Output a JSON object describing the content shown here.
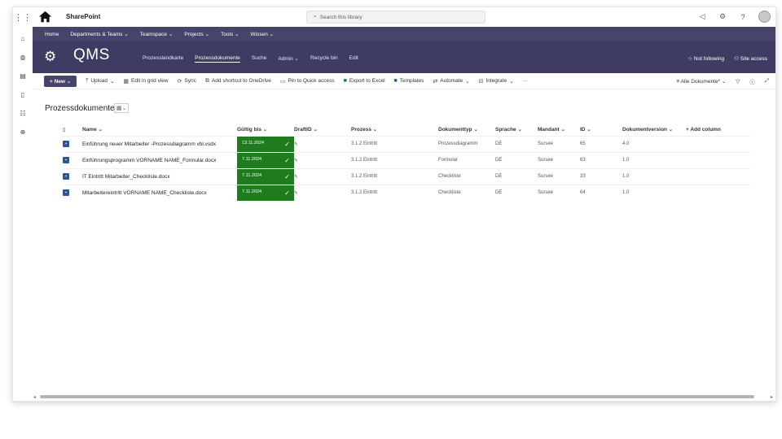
{
  "suite": {
    "brand": "SharePoint",
    "search_placeholder": "Search this library"
  },
  "topnav": {
    "items": [
      "Home",
      "Departments & Teams",
      "Teamspace",
      "Projects",
      "Tools",
      "Wissen"
    ]
  },
  "hub": {
    "title": "QMS",
    "nav": [
      "Prozesslandkarte",
      "Prozessdokumente",
      "Suche",
      "Admin",
      "Recycle bin",
      "Edit"
    ],
    "active": "Prozessdokumente",
    "not_following": "Not following",
    "site_access": "Site access"
  },
  "cmdbar": {
    "new": "New",
    "upload": "Upload",
    "edit_grid": "Edit in grid view",
    "sync": "Sync",
    "add_shortcut": "Add shortcut to OneDrive",
    "pin": "Pin to Quick access",
    "export": "Export to Excel",
    "templates": "Templates",
    "automate": "Automate",
    "integrate": "Integrate",
    "view": "Alle Dokumente*"
  },
  "library": {
    "title": "Prozessdokumente",
    "columns": [
      "Name",
      "Gültig bis",
      "DraftID",
      "Prozess",
      "Dokumenttyp",
      "Sprache",
      "Mandant",
      "ID",
      "Dokumentversion",
      "+ Add column"
    ],
    "rows": [
      {
        "name": "Einführung neuer Mitarbeiter -Prozessdiagramm vbl.vsdx",
        "gueltig": "13.11.2024",
        "prozess": "3.1.2 Eintritt",
        "typ": "Prozessdiagramm",
        "sprache": "DE",
        "mandant": "Sursee",
        "id": "65",
        "version": "4.0"
      },
      {
        "name": "Einführungsprogramm VORNAME NAME_Formular.docx",
        "gueltig": "7.11.2024",
        "prozess": "3.1.2 Eintritt",
        "typ": "Formular",
        "sprache": "DE",
        "mandant": "Sursee",
        "id": "63",
        "version": "1.0"
      },
      {
        "name": "IT Eintritt Mitarbeiter_Checkliste.docx",
        "gueltig": "7.11.2024",
        "prozess": "3.1.2 Eintritt",
        "typ": "Checkliste",
        "sprache": "DE",
        "mandant": "Sursee",
        "id": "33",
        "version": "1.0"
      },
      {
        "name": "Mitarbeitereintritt VORNAME NAME_Checkliste.docx",
        "gueltig": "7.11.2024",
        "prozess": "3.1.2 Eintritt",
        "typ": "Checkliste",
        "sprache": "DE",
        "mandant": "Sursee",
        "id": "64",
        "version": "1.0"
      }
    ]
  }
}
